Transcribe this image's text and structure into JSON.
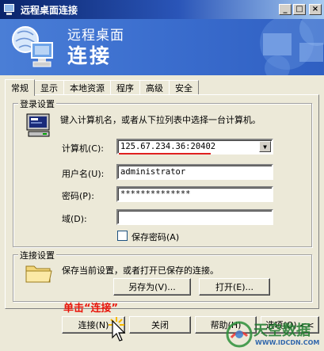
{
  "window": {
    "title": "远程桌面连接"
  },
  "banner": {
    "subtitle": "远程桌面",
    "title": "连接"
  },
  "tabs": [
    "常规",
    "显示",
    "本地资源",
    "程序",
    "高级",
    "安全"
  ],
  "login": {
    "legend": "登录设置",
    "instruction": "键入计算机名，或者从下拉列表中选择一台计算机。",
    "computer_label": "计算机(C):",
    "computer_value": "125.67.234.36:20402",
    "username_label": "用户名(U):",
    "username_value": "administrator",
    "password_label": "密码(P):",
    "password_value": "**************",
    "domain_label": "域(D):",
    "domain_value": "",
    "save_password_label": "保存密码(A)",
    "save_password_checked": false
  },
  "connection": {
    "legend": "连接设置",
    "description": "保存当前设置，或者打开已保存的连接。",
    "save_as_label": "另存为(V)...",
    "open_label": "打开(E)..."
  },
  "annotation": "单击“连接”",
  "buttons": {
    "connect": "连接(N)",
    "close": "关闭",
    "help": "帮助(H)",
    "options": "选项(O) <<"
  },
  "watermark": {
    "brand": "天空数据",
    "url": "WWW.IDCDN.COM"
  }
}
